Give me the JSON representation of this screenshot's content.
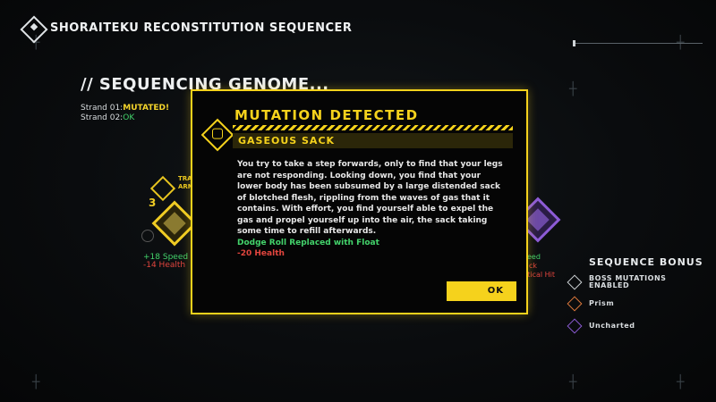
{
  "header": {
    "title": "SHORAITEKU RECONSTITUTION SEQUENCER"
  },
  "sequencer": {
    "title": "// SEQUENCING GENOME...",
    "strands": [
      {
        "label": "Strand 01:",
        "value": "MUTATED!"
      },
      {
        "label": "Strand 02:",
        "value": "OK"
      }
    ],
    "node_number": "3",
    "node_label": "TRA\nARM",
    "stats": {
      "up": "+18 Speed",
      "down": "-14 Health"
    }
  },
  "right_peek": {
    "line1": "eed",
    "line2": "ck",
    "line3": "itical Hit"
  },
  "sequence_bonus": {
    "title": "SEQUENCE BONUS",
    "items": [
      {
        "label": "BOSS MUTATIONS ENABLED",
        "icon": "boss-icon",
        "color": "#cfd4d7"
      },
      {
        "label": "Prism",
        "icon": "prism-icon",
        "color": "#e07a3c"
      },
      {
        "label": "Uncharted",
        "icon": "uncharted-icon",
        "color": "#8d5bd6"
      }
    ]
  },
  "modal": {
    "title": "MUTATION DETECTED",
    "subtitle": "GASEOUS SACK",
    "body": "You try to take a step forwards, only to find that your legs are not responding. Looking down, you find that your lower body has been subsumed by a large distended sack of blotched flesh, rippling from the waves of gas that it contains. With effort, you find yourself able to expel the gas and propel yourself up into the air, the sack taking some time to refill afterwards.",
    "effect_positive": "Dodge Roll Replaced with Float",
    "effect_negative": "-20 Health",
    "ok_label": "OK"
  },
  "colors": {
    "accent": "#f5d21c",
    "good": "#43d36b",
    "bad": "#e2453e",
    "purple": "#8d5bd6"
  }
}
